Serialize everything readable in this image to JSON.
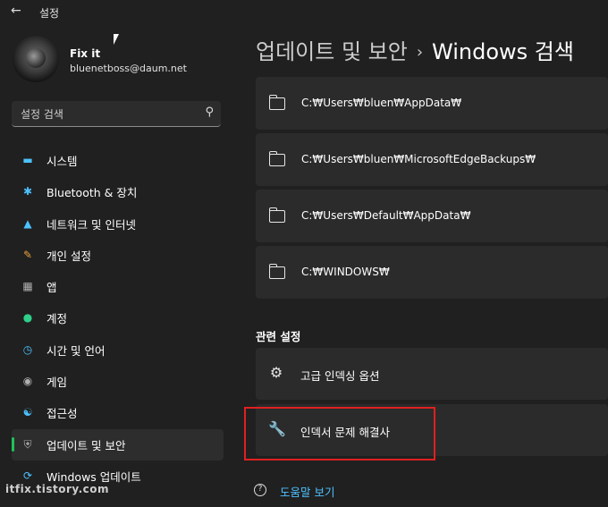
{
  "app": {
    "title": "설정",
    "back_icon": "back-arrow-icon"
  },
  "profile": {
    "name": "Fix it",
    "email": "bluenetboss@daum.net"
  },
  "search": {
    "placeholder": "설정 검색",
    "icon": "search-icon"
  },
  "sidebar": {
    "items": [
      {
        "label": "시스템",
        "icon": "system-icon",
        "color": "#4cc2ff"
      },
      {
        "label": "Bluetooth & 장치",
        "icon": "bluetooth-icon",
        "color": "#4cc2ff"
      },
      {
        "label": "네트워크 및 인터넷",
        "icon": "wifi-icon",
        "color": "#4cc2ff"
      },
      {
        "label": "개인 설정",
        "icon": "brush-icon",
        "color": "#e8a33d"
      },
      {
        "label": "앱",
        "icon": "apps-icon",
        "color": "#b0b0b0"
      },
      {
        "label": "계정",
        "icon": "account-icon",
        "color": "#2fd08a"
      },
      {
        "label": "시간 및 언어",
        "icon": "globe-clock-icon",
        "color": "#4cc2ff"
      },
      {
        "label": "게임",
        "icon": "gamepad-icon",
        "color": "#b0b0b0"
      },
      {
        "label": "접근성",
        "icon": "accessibility-icon",
        "color": "#4cc2ff"
      },
      {
        "label": "업데이트 및 보안",
        "icon": "shield-icon",
        "color": "#b0b0b0",
        "selected": true
      },
      {
        "label": "Windows 업데이트",
        "icon": "windows-update-icon",
        "color": "#4cc2ff"
      }
    ]
  },
  "header": {
    "breadcrumb_parent": "업데이트 및 보안",
    "separator": "›",
    "current": "Windows 검색"
  },
  "folders": [
    "C:₩Users₩bluen₩AppData₩",
    "C:₩Users₩bluen₩MicrosoftEdgeBackups₩",
    "C:₩Users₩Default₩AppData₩",
    "C:₩WINDOWS₩"
  ],
  "related": {
    "heading": "관련 설정",
    "items": [
      {
        "label": "고급 인덱싱 옵션",
        "icon": "gear-icon"
      },
      {
        "label": "인덱서 문제 해결사",
        "icon": "wrench-icon"
      }
    ]
  },
  "help": {
    "label": "도움말 보기",
    "icon": "help-icon"
  },
  "watermark": "itfix.tistory.com",
  "colors": {
    "background": "#202020",
    "card": "#2b2b2b",
    "accent": "#1fc35a",
    "link": "#4cc2ff",
    "highlight": "#e02020"
  }
}
